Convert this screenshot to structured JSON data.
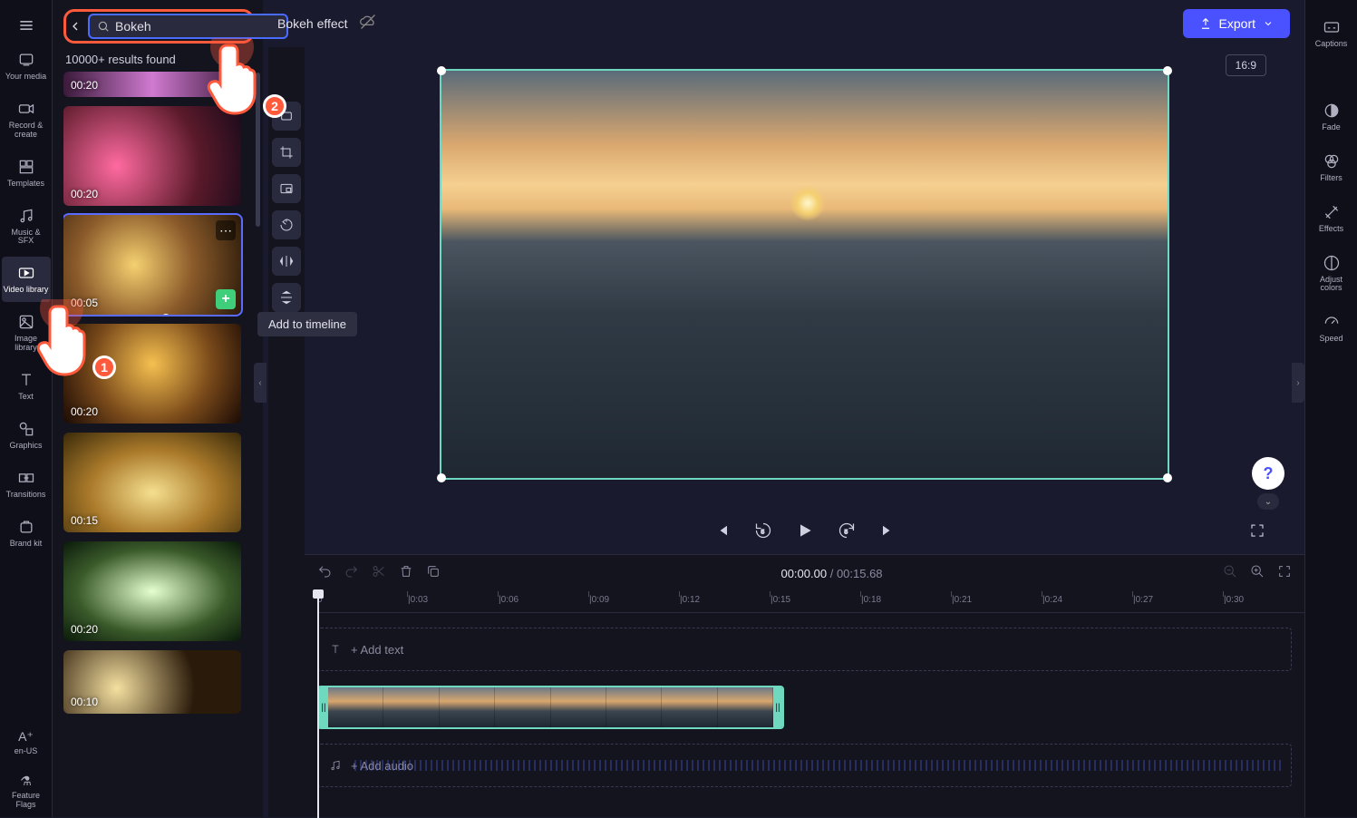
{
  "left_rail": {
    "your_media": "Your media",
    "record_create": "Record & create",
    "templates": "Templates",
    "music_sfx": "Music & SFX",
    "video_library": "Video library",
    "image_library": "Image library",
    "text": "Text",
    "graphics": "Graphics",
    "transitions": "Transitions",
    "brand_kit": "Brand kit",
    "locale": "en-US",
    "feature_flags": "Feature Flags"
  },
  "sidebar": {
    "search_value": "Bokeh",
    "results_label": "10000+ results found",
    "add_tooltip": "Add to timeline",
    "thumbs": [
      {
        "dur": "00:20"
      },
      {
        "dur": "00:20"
      },
      {
        "dur": "00:05"
      },
      {
        "dur": "00:20"
      },
      {
        "dur": "00:15"
      },
      {
        "dur": "00:20"
      },
      {
        "dur": "00:10"
      }
    ]
  },
  "callouts": {
    "one": "1",
    "two": "2"
  },
  "topbar": {
    "title": "Bokeh effect",
    "export": "Export",
    "aspect": "16:9"
  },
  "right_rail": {
    "captions": "Captions",
    "fade": "Fade",
    "filters": "Filters",
    "effects": "Effects",
    "adjust": "Adjust colors",
    "speed": "Speed"
  },
  "timeline": {
    "current": "00:00.00",
    "total": "00:15.68",
    "ticks": [
      "0",
      "|0:03",
      "|0:06",
      "|0:09",
      "|0:12",
      "|0:15",
      "|0:18",
      "|0:21",
      "|0:24",
      "|0:27",
      "|0:30"
    ],
    "add_text": "+ Add text",
    "add_audio": "+ Add audio"
  },
  "colors": {
    "accent": "#4a51ff",
    "callout": "#ff5a3c",
    "select": "#6fd9c0"
  }
}
